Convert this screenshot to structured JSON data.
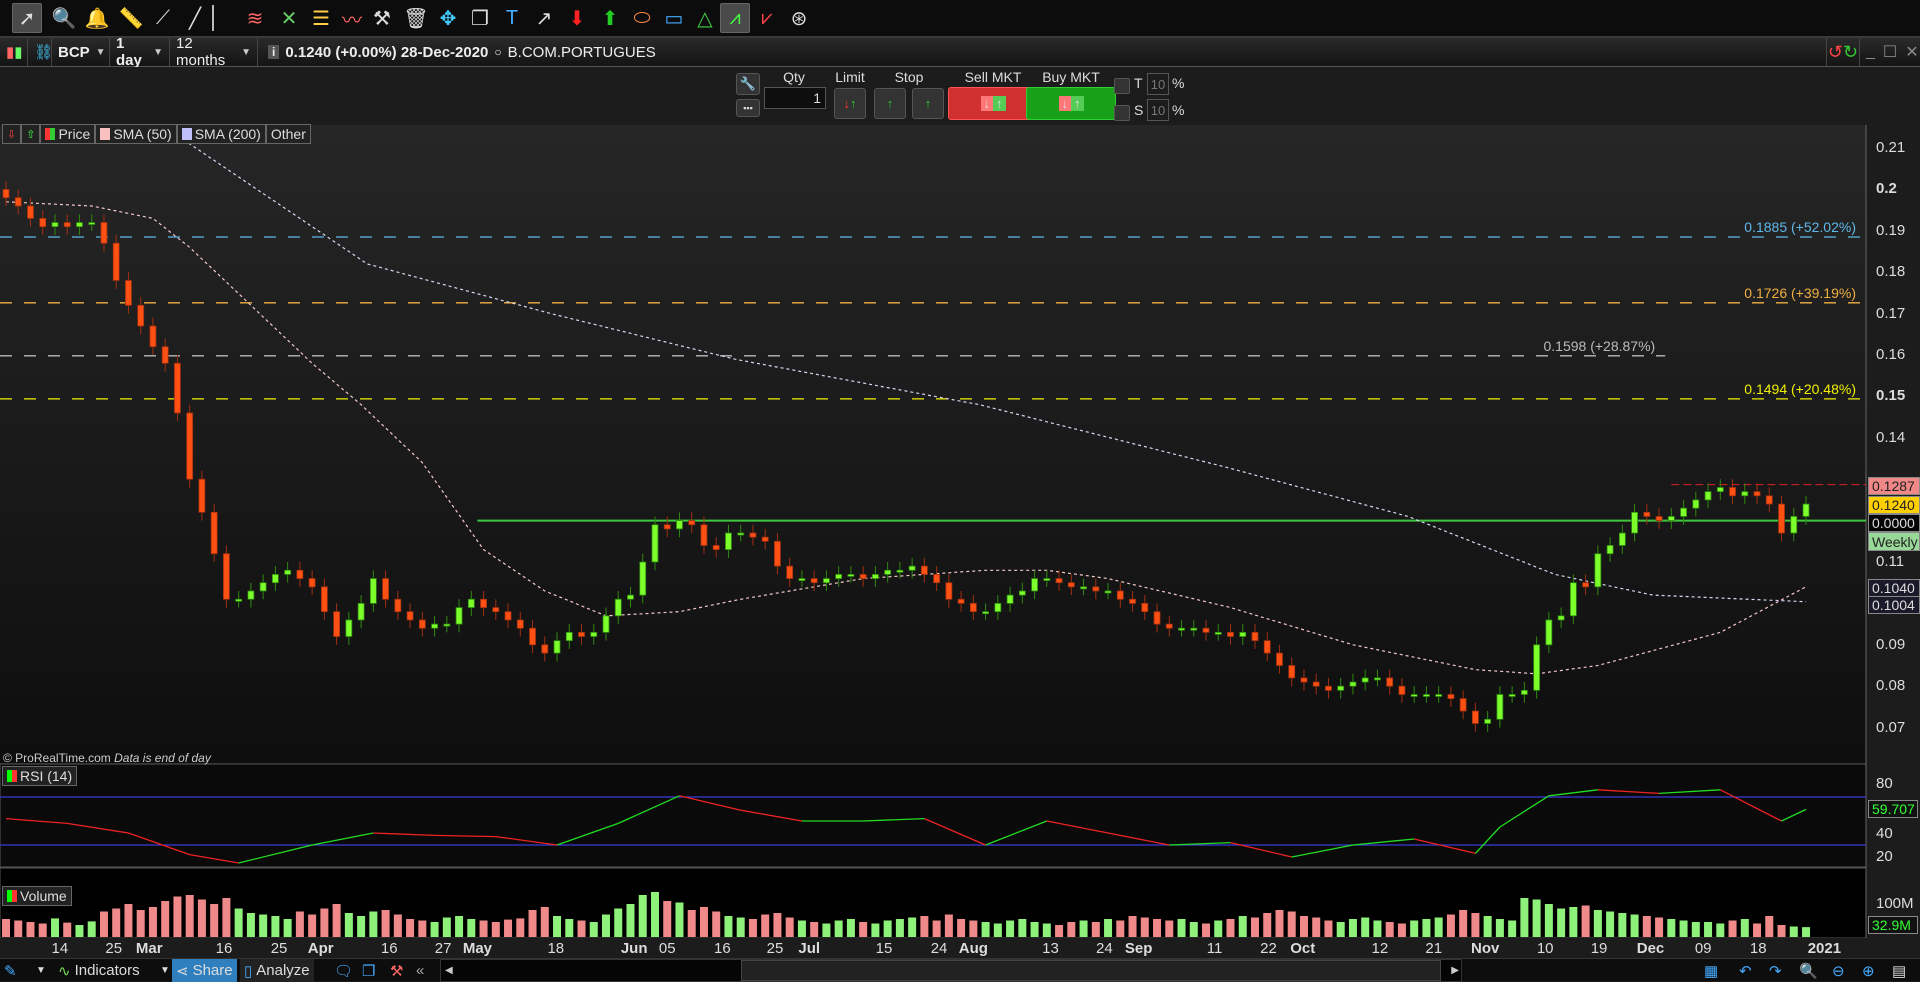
{
  "toolbar": {
    "icons": [
      "cursor-icon",
      "magnifier-icon",
      "alert-bell-icon",
      "ruler-icon",
      "segment-icon",
      "line-icon",
      "channel-icon",
      "fork-icon",
      "fibonacci-icon",
      "wave-icon",
      "tools-icon",
      "trash-icon",
      "move-icon",
      "copy-icon",
      "text-icon",
      "arrow-icon",
      "down-arrow-icon",
      "up-arrow-icon",
      "ellipse-icon",
      "rectangle-icon",
      "triangle-icon",
      "zigzag-icon",
      "zigzag-alt-icon",
      "reset-icon"
    ]
  },
  "symbol_bar": {
    "ticker": "BCP",
    "interval": "1 day",
    "period": "12 months",
    "quote": "0.1240 (+0.00%) 28-Dec-2020",
    "name": "B.COM.PORTUGUES"
  },
  "order_bar": {
    "qty_label": "Qty",
    "qty_value": "1",
    "limit_label": "Limit",
    "stop_label": "Stop",
    "sell_label": "Sell MKT",
    "buy_label": "Buy MKT",
    "t_label": "T",
    "t_value": "10",
    "s_label": "S",
    "s_value": "10",
    "pct": "%"
  },
  "legend": {
    "price": "Price",
    "sma50": "SMA (50)",
    "sma200": "SMA (200)",
    "other": "Other"
  },
  "copyright": "© ProRealTime.com",
  "data_note": "Data is end of day",
  "rsi": {
    "label": "RSI (14)",
    "ticks": [
      "80",
      "40",
      "20"
    ],
    "value": "59.707"
  },
  "volume": {
    "label": "Volume",
    "tick": "100M",
    "value": "32.9M"
  },
  "price_axis": {
    "ticks": [
      "0.21",
      "0.2",
      "0.19",
      "0.18",
      "0.17",
      "0.16",
      "0.15",
      "0.14",
      "0.11",
      "0.09",
      "0.08",
      "0.07"
    ],
    "boxes": {
      "high": "0.1287",
      "last": "0.1240",
      "line": "0.0000",
      "weekly": "Weekly",
      "sma50": "0.1040",
      "sma200": "0.1004"
    }
  },
  "levels": [
    {
      "price": 0.1885,
      "label": "0.1885 (+52.02%)",
      "color": "#5fb8e8"
    },
    {
      "price": 0.1726,
      "label": "0.1726 (+39.19%)",
      "color": "#f0b040"
    },
    {
      "price": 0.1598,
      "label": "0.1598 (+28.87%)",
      "color": "#bbbbbb",
      "end": 135.5
    },
    {
      "price": 0.1494,
      "label": "0.1494 (+20.48%)",
      "color": "#f0f000"
    }
  ],
  "bottom_bar": {
    "indicators": "Indicators",
    "share": "Share",
    "analyze": "Analyze",
    "prev": "«"
  },
  "colors": {
    "up": "#7cff2a",
    "down": "#ff5014",
    "support": "#3fc83f",
    "resistance": "#e02020",
    "rsi_band": "#3b3bd8"
  },
  "chart_data": {
    "type": "candlestick",
    "ylim": [
      0.065,
      0.215
    ],
    "closes": [
      0.198,
      0.196,
      0.193,
      0.191,
      0.192,
      0.191,
      0.192,
      0.192,
      0.187,
      0.178,
      0.172,
      0.167,
      0.162,
      0.158,
      0.146,
      0.13,
      0.122,
      0.112,
      0.101,
      0.101,
      0.103,
      0.105,
      0.107,
      0.108,
      0.106,
      0.104,
      0.098,
      0.092,
      0.096,
      0.1,
      0.106,
      0.101,
      0.098,
      0.096,
      0.094,
      0.095,
      0.095,
      0.099,
      0.101,
      0.099,
      0.098,
      0.096,
      0.094,
      0.09,
      0.088,
      0.091,
      0.093,
      0.092,
      0.093,
      0.097,
      0.101,
      0.102,
      0.11,
      0.119,
      0.118,
      0.12,
      0.119,
      0.114,
      0.113,
      0.117,
      0.117,
      0.116,
      0.115,
      0.109,
      0.106,
      0.106,
      0.105,
      0.106,
      0.107,
      0.107,
      0.106,
      0.107,
      0.108,
      0.108,
      0.109,
      0.107,
      0.105,
      0.101,
      0.1,
      0.098,
      0.098,
      0.1,
      0.102,
      0.103,
      0.106,
      0.106,
      0.105,
      0.104,
      0.104,
      0.103,
      0.103,
      0.101,
      0.1,
      0.098,
      0.095,
      0.094,
      0.094,
      0.094,
      0.093,
      0.093,
      0.092,
      0.093,
      0.091,
      0.088,
      0.085,
      0.082,
      0.081,
      0.08,
      0.079,
      0.08,
      0.081,
      0.082,
      0.082,
      0.08,
      0.078,
      0.078,
      0.078,
      0.078,
      0.077,
      0.074,
      0.071,
      0.072,
      0.078,
      0.078,
      0.079,
      0.09,
      0.096,
      0.097,
      0.105,
      0.104,
      0.112,
      0.114,
      0.117,
      0.122,
      0.121,
      0.12,
      0.121,
      0.123,
      0.125,
      0.127,
      0.128,
      0.126,
      0.127,
      0.126,
      0.124,
      0.117,
      0.121,
      0.124
    ],
    "volumes_m": [
      60,
      55,
      50,
      45,
      62,
      48,
      40,
      52,
      85,
      95,
      110,
      90,
      100,
      120,
      135,
      140,
      125,
      110,
      130,
      95,
      80,
      75,
      70,
      60,
      85,
      75,
      95,
      110,
      80,
      70,
      85,
      90,
      75,
      60,
      55,
      50,
      65,
      70,
      60,
      55,
      50,
      58,
      62,
      90,
      100,
      70,
      60,
      55,
      50,
      75,
      95,
      110,
      140,
      150,
      120,
      115,
      90,
      100,
      85,
      70,
      65,
      60,
      75,
      80,
      65,
      55,
      50,
      45,
      55,
      60,
      50,
      45,
      55,
      60,
      65,
      70,
      55,
      75,
      60,
      55,
      50,
      45,
      55,
      60,
      50,
      45,
      40,
      50,
      55,
      50,
      60,
      55,
      70,
      65,
      60,
      55,
      60,
      50,
      45,
      55,
      60,
      70,
      65,
      80,
      90,
      85,
      70,
      65,
      55,
      50,
      60,
      65,
      55,
      50,
      45,
      55,
      60,
      65,
      75,
      90,
      80,
      70,
      60,
      55,
      130,
      125,
      110,
      95,
      100,
      105,
      90,
      85,
      80,
      75,
      70,
      65,
      60,
      55,
      50,
      50,
      45,
      55,
      60,
      45,
      70,
      40,
      35,
      32.9
    ],
    "sma50": [
      [
        0,
        0.197
      ],
      [
        7,
        0.196
      ],
      [
        12,
        0.193
      ],
      [
        15,
        0.186
      ],
      [
        20,
        0.172
      ],
      [
        25,
        0.158
      ],
      [
        29,
        0.148
      ],
      [
        34,
        0.134
      ],
      [
        39,
        0.113
      ],
      [
        44,
        0.103
      ],
      [
        49,
        0.097
      ],
      [
        55,
        0.098
      ],
      [
        60,
        0.101
      ],
      [
        70,
        0.106
      ],
      [
        80,
        0.108
      ],
      [
        85,
        0.108
      ],
      [
        90,
        0.106
      ],
      [
        100,
        0.099
      ],
      [
        110,
        0.09
      ],
      [
        120,
        0.084
      ],
      [
        125,
        0.083
      ],
      [
        130,
        0.085
      ],
      [
        140,
        0.093
      ],
      [
        147,
        0.104
      ]
    ],
    "sma200": [
      [
        14.5,
        0.212
      ],
      [
        29.5,
        0.182
      ],
      [
        44.5,
        0.17
      ],
      [
        59.5,
        0.159
      ],
      [
        79.5,
        0.148
      ],
      [
        99.5,
        0.133
      ],
      [
        114.5,
        0.121
      ],
      [
        126.5,
        0.107
      ],
      [
        134.5,
        0.102
      ],
      [
        147,
        0.1004
      ]
    ],
    "rsi": [
      [
        0,
        52
      ],
      [
        5,
        48
      ],
      [
        10,
        40
      ],
      [
        15,
        22
      ],
      [
        19,
        15
      ],
      [
        25,
        30
      ],
      [
        30,
        40
      ],
      [
        35,
        38
      ],
      [
        40,
        37
      ],
      [
        45,
        30
      ],
      [
        50,
        48
      ],
      [
        55,
        71
      ],
      [
        60,
        59
      ],
      [
        65,
        50
      ],
      [
        70,
        50
      ],
      [
        75,
        52
      ],
      [
        80,
        30
      ],
      [
        85,
        50
      ],
      [
        90,
        40
      ],
      [
        95,
        30
      ],
      [
        100,
        32
      ],
      [
        105,
        20
      ],
      [
        110,
        30
      ],
      [
        115,
        35
      ],
      [
        120,
        23
      ],
      [
        122,
        45
      ],
      [
        126,
        71
      ],
      [
        130,
        76
      ],
      [
        135,
        73
      ],
      [
        140,
        76
      ],
      [
        145,
        50
      ],
      [
        147,
        59.707
      ]
    ],
    "rsi_bands": [
      70,
      30
    ],
    "support_line": {
      "price": 0.12,
      "start": 38.5
    },
    "resistance_line": {
      "price": 0.1287,
      "start": 136
    },
    "x_ticks": [
      {
        "label": "14",
        "bar": 4.4
      },
      {
        "label": "25",
        "bar": 8.8
      },
      {
        "label": "Mar",
        "bar": 11.7,
        "bold": true
      },
      {
        "label": "16",
        "bar": 17.8
      },
      {
        "label": "25",
        "bar": 22.3
      },
      {
        "label": "Apr",
        "bar": 25.7,
        "bold": true
      },
      {
        "label": "16",
        "bar": 31.3
      },
      {
        "label": "27",
        "bar": 35.7
      },
      {
        "label": "May",
        "bar": 38.5,
        "bold": true
      },
      {
        "label": "18",
        "bar": 44.9
      },
      {
        "label": "Jun",
        "bar": 51.3,
        "bold": true
      },
      {
        "label": "05",
        "bar": 54
      },
      {
        "label": "16",
        "bar": 58.5
      },
      {
        "label": "25",
        "bar": 62.8
      },
      {
        "label": "Jul",
        "bar": 65.6,
        "bold": true
      },
      {
        "label": "15",
        "bar": 71.7
      },
      {
        "label": "24",
        "bar": 76.2
      },
      {
        "label": "Aug",
        "bar": 79,
        "bold": true
      },
      {
        "label": "13",
        "bar": 85.3
      },
      {
        "label": "24",
        "bar": 89.7
      },
      {
        "label": "Sep",
        "bar": 92.5,
        "bold": true
      },
      {
        "label": "11",
        "bar": 98.7
      },
      {
        "label": "22",
        "bar": 103.1
      },
      {
        "label": "Oct",
        "bar": 105.9,
        "bold": true
      },
      {
        "label": "12",
        "bar": 112.2
      },
      {
        "label": "21",
        "bar": 116.6
      },
      {
        "label": "Nov",
        "bar": 120.8,
        "bold": true
      },
      {
        "label": "10",
        "bar": 125.7
      },
      {
        "label": "19",
        "bar": 130.1
      },
      {
        "label": "Dec",
        "bar": 134.3,
        "bold": true
      },
      {
        "label": "09",
        "bar": 138.6
      },
      {
        "label": "18",
        "bar": 143.1
      },
      {
        "label": "2021",
        "bar": 148.5,
        "bold": true
      }
    ]
  }
}
